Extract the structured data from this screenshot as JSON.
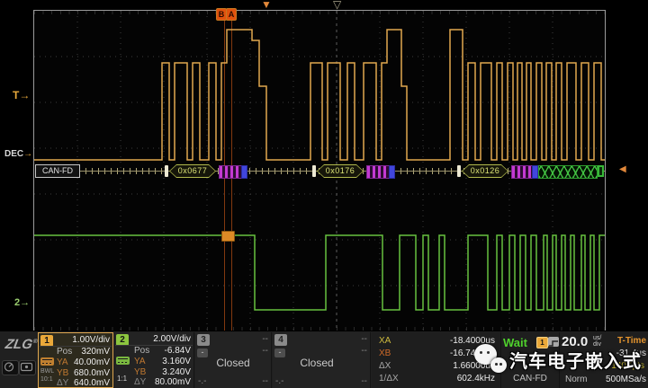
{
  "watermark": {
    "text": "汽车电子嵌入式"
  },
  "scope": {
    "left_labels": {
      "trigger": "T",
      "trigger_arrow": "→",
      "decode": "DEC",
      "decode_arrow": "→",
      "ch2": "2",
      "ch2_arrow": "→"
    },
    "cursors": {
      "b": "B",
      "a": "A"
    },
    "markers": {
      "trigger_triangle": "▼",
      "center_triangle": "▽",
      "decode_right_arrow": "◀"
    },
    "decode": {
      "protocol_tag": "CAN-FD",
      "frames": [
        {
          "id": "0x0677"
        },
        {
          "id": "0x0176"
        },
        {
          "id": "0x0126"
        }
      ]
    }
  },
  "status_bar": {
    "brand": {
      "name": "ZLG",
      "reg": "®"
    },
    "channels": [
      {
        "num": "1",
        "scale": "1.00V/div",
        "pos_label": "Pos",
        "pos": "320mV",
        "ya_label": "YA",
        "ya": "40.00mV",
        "yb_label": "YB",
        "yb": "680.0mV",
        "dy_label": "ΔY",
        "dy": "640.0mV",
        "bw": "BWL",
        "probe": "10:1"
      },
      {
        "num": "2",
        "scale": "2.00V/div",
        "pos_label": "Pos",
        "pos": "-6.84V",
        "ya_label": "YA",
        "ya": "3.160V",
        "yb_label": "YB",
        "yb": "3.240V",
        "dy_label": "ΔY",
        "dy": "80.00mV",
        "probe": "1:1"
      },
      {
        "num": "3",
        "state": "Closed",
        "top_dash": "--",
        "mid_dash": "--",
        "minus": "-",
        "bl": "-.-",
        "br": "--"
      },
      {
        "num": "4",
        "state": "Closed",
        "top_dash": "--",
        "mid_dash": "--",
        "minus": "-",
        "bl": "-.-",
        "br": "--"
      }
    ],
    "cursor_readout": {
      "xa_label": "XA",
      "xa": "-18.4000us",
      "xb_label": "XB",
      "xb": "-16.7400us",
      "dx_label": "ΔX",
      "dx": "1.66000us",
      "fx_label": "1/ΔX",
      "fx": "602.4kHz"
    },
    "trigger": {
      "status": "Wait",
      "source": "1",
      "protocol": "CAN-FD"
    },
    "timebase": {
      "scale": "20.0",
      "unit_top": "us/",
      "unit_bottom": "div",
      "t_time_label": "T-Time",
      "t_time": "-31.4us",
      "depth": "140Kpts",
      "acq_mode": "Norm",
      "sample_rate": "500MSa/s"
    }
  }
}
